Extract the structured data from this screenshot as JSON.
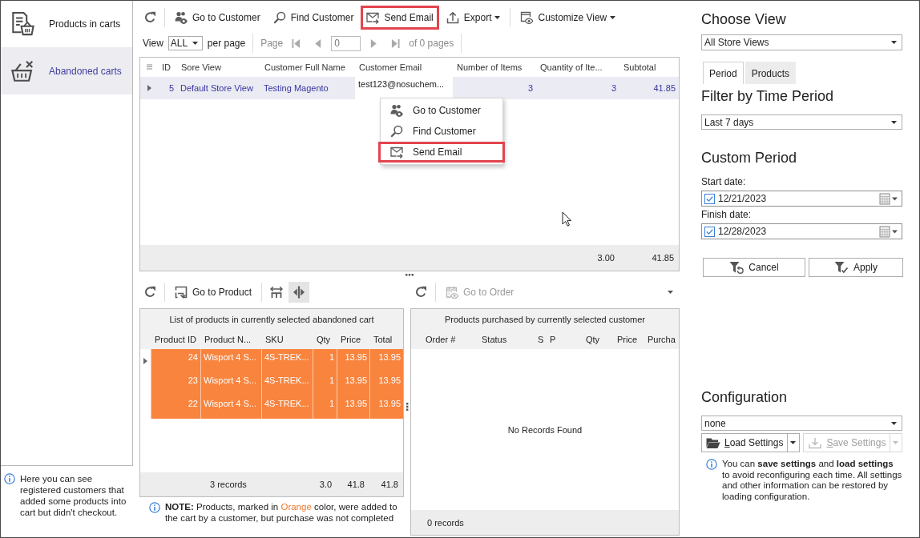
{
  "sidebar": {
    "items": [
      {
        "kind": "products",
        "label": "Products in carts",
        "selected": false
      },
      {
        "kind": "abandoned",
        "label": "Abandoned carts",
        "selected": true
      }
    ],
    "info": "Here you can see registered customers that added some products into cart but didn't checkout."
  },
  "toolbar": {
    "items": [
      {
        "kind": "refresh",
        "highlighted": false,
        "dropdown": false
      },
      {
        "kind": "separator"
      },
      {
        "kind": "go-customer",
        "label": "Go to Customer",
        "highlighted": false,
        "dropdown": false
      },
      {
        "kind": "find",
        "label": "Find Customer",
        "highlighted": false,
        "dropdown": false
      },
      {
        "kind": "send-email",
        "label": "Send Email",
        "highlighted": true,
        "dropdown": false
      },
      {
        "kind": "export",
        "label": "Export",
        "highlighted": false,
        "dropdown": true
      },
      {
        "kind": "separator"
      },
      {
        "kind": "customize",
        "label": "Customize View",
        "highlighted": false,
        "dropdown": true
      }
    ]
  },
  "pager": {
    "view_label": "View",
    "page_size": "ALL",
    "per_page_label": "per page",
    "page_label": "Page",
    "page_value": "0",
    "page_count": "of 0 pages",
    "disabled": true
  },
  "carts_table": {
    "columns": [
      "ID",
      "Sore View",
      "Customer Full Name",
      "Customer Email",
      "Number of Items",
      "Quantity of Ite...",
      "Subtotal"
    ],
    "rows": [
      {
        "selected": true,
        "cells": [
          {
            "text": "5",
            "focused": false
          },
          {
            "text": "Default Store View",
            "focused": false
          },
          {
            "text": "Testing Magento",
            "focused": false
          },
          {
            "text": "test123@nosuchem...",
            "focused": true
          },
          {
            "text": "3",
            "focused": false
          },
          {
            "text": "3",
            "focused": false
          },
          {
            "text": "41.85",
            "focused": false
          }
        ]
      }
    ],
    "footer": [
      "3.00",
      "41.85"
    ]
  },
  "context_menu": {
    "items": [
      {
        "kind": "go-customer",
        "label": "Go to Customer",
        "highlighted": false
      },
      {
        "kind": "find",
        "label": "Find Customer",
        "highlighted": false
      },
      {
        "kind": "send-email",
        "label": "Send Email",
        "highlighted": true
      }
    ]
  },
  "products_panel": {
    "toolbar": {
      "items": [
        {
          "kind": "refresh",
          "selected": false
        },
        {
          "kind": "separator"
        },
        {
          "kind": "go-product",
          "label": "Go to Product",
          "selected": false
        },
        {
          "kind": "separator"
        },
        {
          "kind": "fit-columns",
          "selected": false
        },
        {
          "kind": "split-view",
          "selected": true
        }
      ]
    },
    "table": {
      "title": "List of products in currently selected abandoned cart",
      "columns": [
        "Product ID",
        "Product N...",
        "SKU",
        "Qty",
        "Price",
        "Total"
      ],
      "rows": [
        {
          "selected": true,
          "abandoned": true,
          "cells": [
            "24",
            "Wisport 4 S...",
            "4S-TREK...",
            "1",
            "13.95",
            "13.95"
          ]
        },
        {
          "selected": false,
          "abandoned": true,
          "cells": [
            "23",
            "Wisport 4 S...",
            "4S-TREK...",
            "1",
            "13.95",
            "13.95"
          ]
        },
        {
          "selected": false,
          "abandoned": true,
          "cells": [
            "22",
            "Wisport 4 S...",
            "4S-TREK...",
            "1",
            "13.95",
            "13.95"
          ]
        }
      ],
      "footer": {
        "records": "3 records",
        "totals": [
          "3.0",
          "41.8",
          "41.8"
        ]
      }
    },
    "note": {
      "parts": [
        {
          "kind": "bold",
          "text": "NOTE:"
        },
        {
          "kind": "plain",
          "text": " Products, marked in "
        },
        {
          "kind": "accent",
          "text": "Orange"
        },
        {
          "kind": "plain",
          "text": " color, were added to the cart by a customer, but purchase was not completed"
        }
      ]
    }
  },
  "orders_panel": {
    "toolbar": {
      "items": [
        {
          "kind": "refresh",
          "disabled": false
        },
        {
          "kind": "separator"
        },
        {
          "kind": "go-order",
          "label": "Go to Order",
          "disabled": true
        }
      ]
    },
    "table": {
      "title": "Products purchased by currently selected customer",
      "columns": [
        "Order #",
        "Status",
        "S",
        "P",
        "Qty",
        "Price",
        "Purcha"
      ],
      "empty_text": "No Records Found",
      "footer": "0 records"
    }
  },
  "view_selector": {
    "heading": "Choose View",
    "value": "All Store Views"
  },
  "tabs": [
    {
      "label": "Period",
      "selected": true
    },
    {
      "label": "Products",
      "selected": false
    }
  ],
  "time_filter": {
    "heading": "Filter by Time Period",
    "value": "Last 7 days"
  },
  "custom_period": {
    "heading": "Custom Period",
    "fields": [
      {
        "label": "Start date:",
        "value": "12/21/2023",
        "checked": true
      },
      {
        "label": "Finish date:",
        "value": "12/28/2023",
        "checked": true
      }
    ],
    "buttons": [
      {
        "kind": "cancel",
        "label": "Cancel"
      },
      {
        "kind": "apply",
        "label": "Apply"
      }
    ]
  },
  "configuration": {
    "heading": "Configuration",
    "value": "none",
    "buttons": [
      {
        "kind": "load",
        "label": "Load Settings",
        "disabled": false,
        "mnemonic": true
      },
      {
        "kind": "save",
        "label": "Save Settings",
        "disabled": true,
        "mnemonic": true
      }
    ],
    "info": "You can **save settings** and **load settings** to avoid reconfiguring each time. All settings and other information can be restored by loading configuration."
  }
}
